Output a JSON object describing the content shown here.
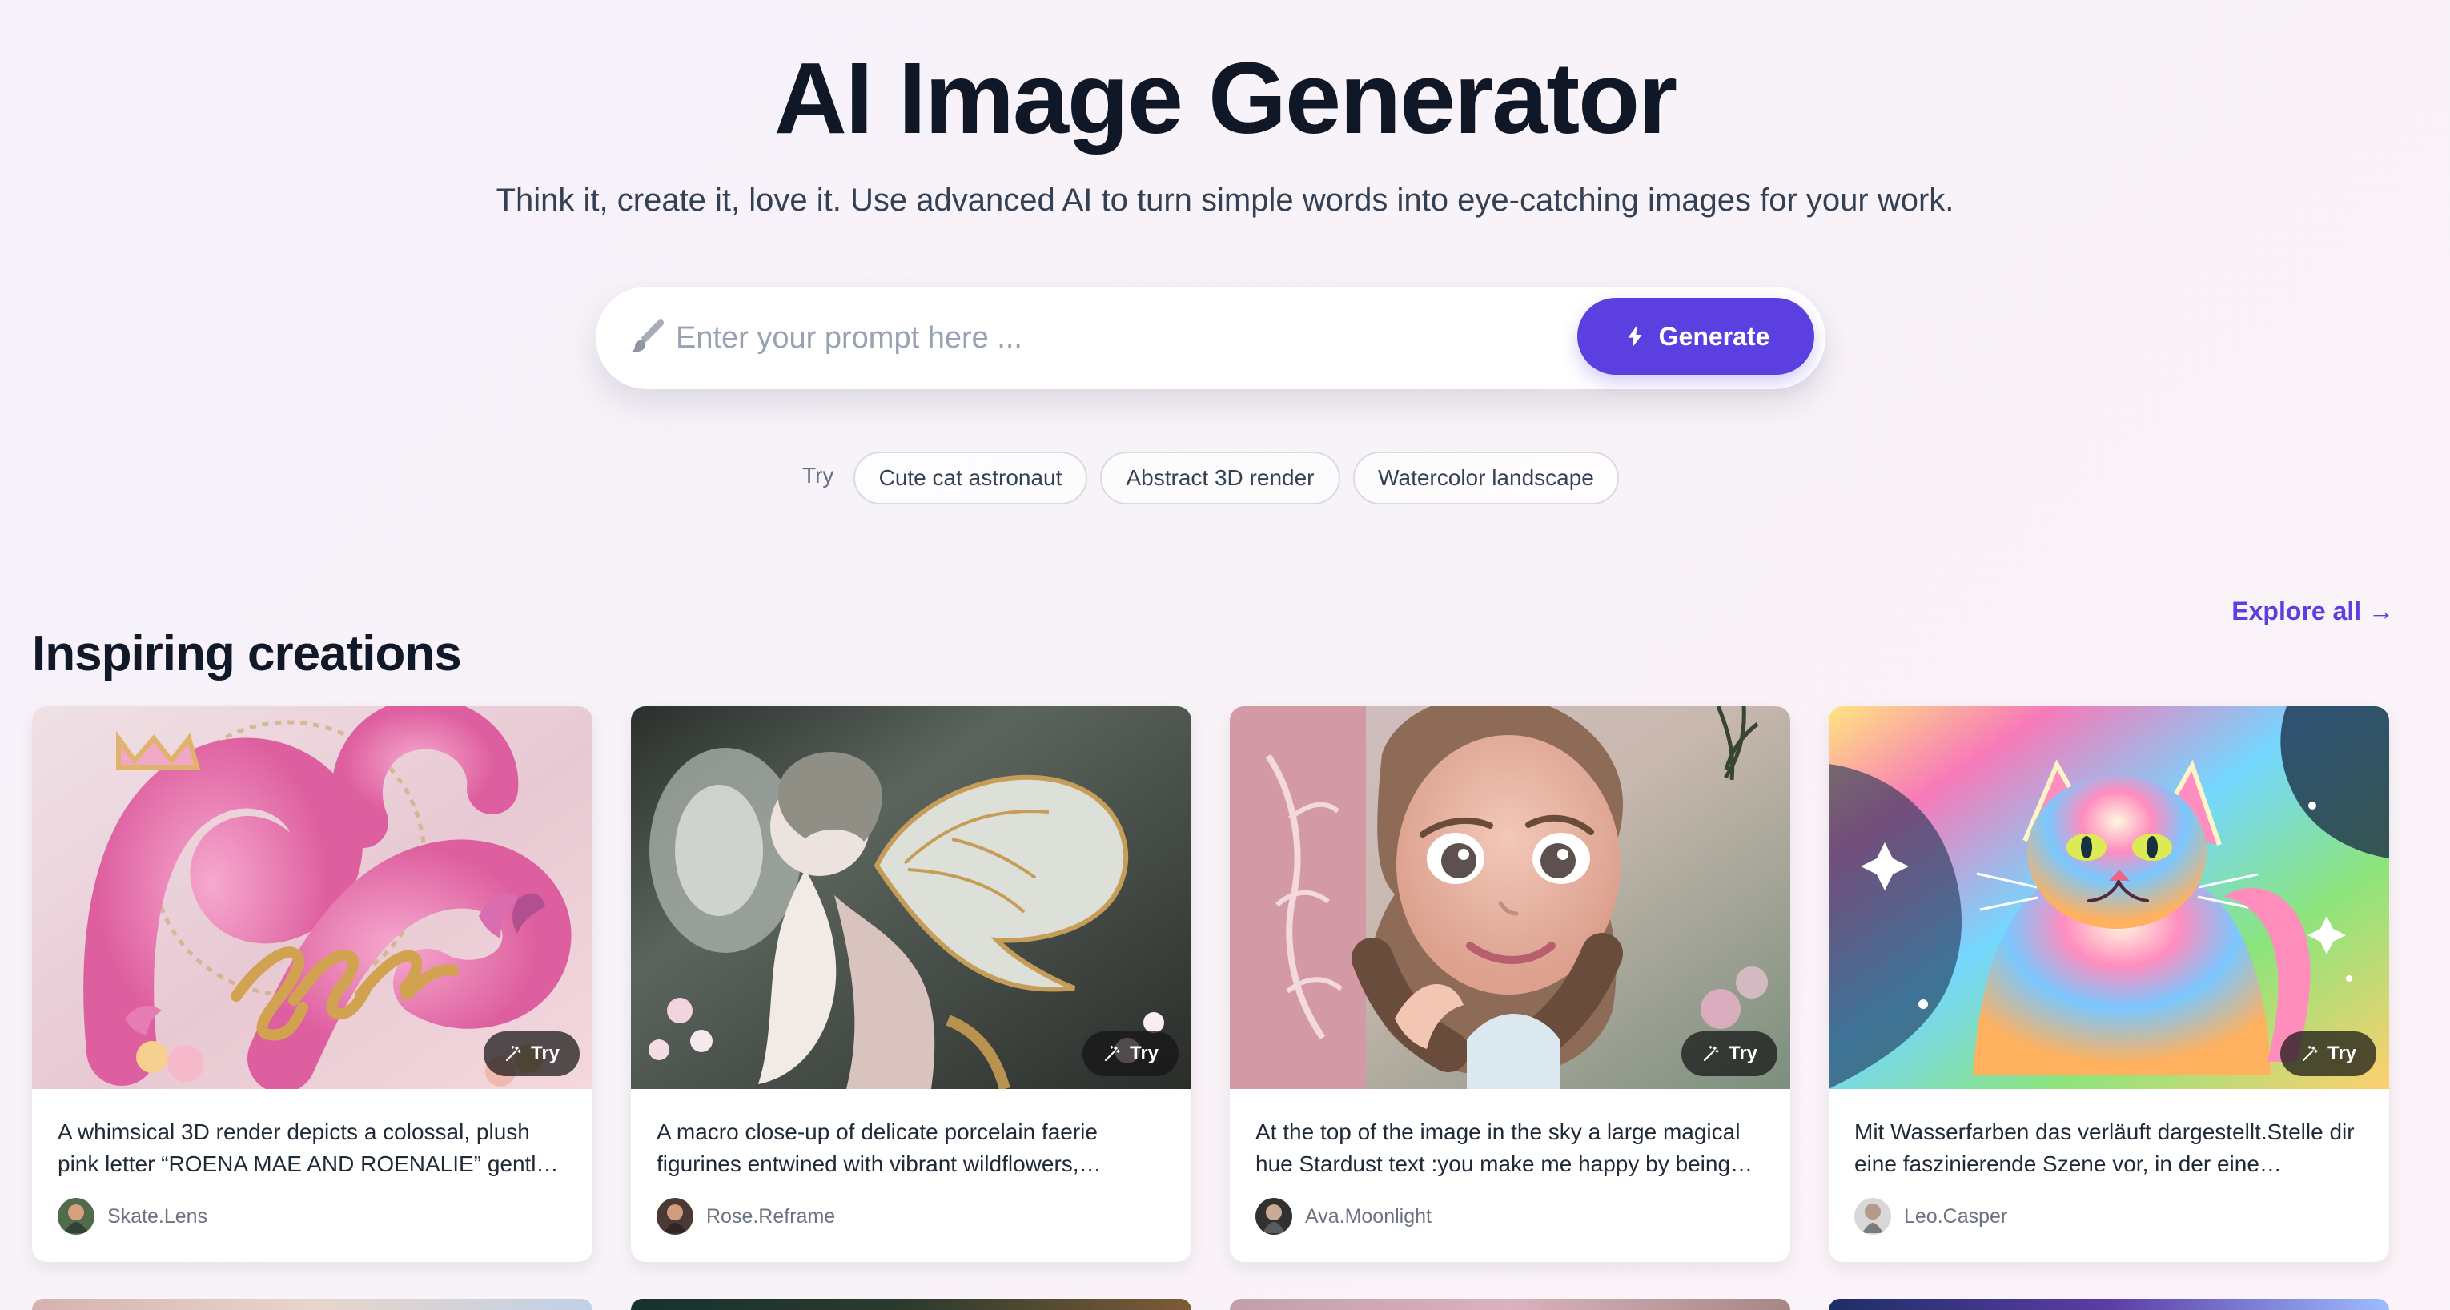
{
  "hero": {
    "title": "AI Image Generator",
    "subtitle": "Think it, create it, love it. Use advanced AI to turn simple words into eye-catching images for your work.",
    "prompt_placeholder": "Enter your prompt here ...",
    "generate_label": "Generate",
    "brush_icon": "brush-icon",
    "generate_icon": "bolt-icon"
  },
  "suggestions": {
    "label": "Try",
    "chips": [
      "Cute cat astronaut",
      "Abstract 3D render",
      "Watercolor landscape"
    ]
  },
  "section": {
    "title": "Inspiring creations",
    "explore_label": "Explore all →",
    "explore_icon": "arrow-right-icon"
  },
  "cards": [
    {
      "description": "A whimsical 3D render depicts a colossal, plush pink letter “ROENA MAE AND ROENALIE” gentl…",
      "username": "Skate.Lens",
      "try_label": "Try",
      "try_icon": "wand-icon"
    },
    {
      "description": "A macro close-up of delicate porcelain faerie figurines entwined with vibrant wildflowers,…",
      "username": "Rose.Reframe",
      "try_label": "Try",
      "try_icon": "wand-icon"
    },
    {
      "description": "At the top of the image in the sky a large magical hue Stardust text :you make me happy by being…",
      "username": "Ava.Moonlight",
      "try_label": "Try",
      "try_icon": "wand-icon"
    },
    {
      "description": "Mit Wasserfarben das verläuft dargestellt.Stelle dir eine faszinierende Szene vor, in der eine…",
      "username": "Leo.Casper",
      "try_label": "Try",
      "try_icon": "wand-icon"
    }
  ],
  "colors": {
    "accent": "#5b3fe0",
    "title": "#101828",
    "subtitle": "#344054",
    "chip_border": "#d8dbe3"
  }
}
